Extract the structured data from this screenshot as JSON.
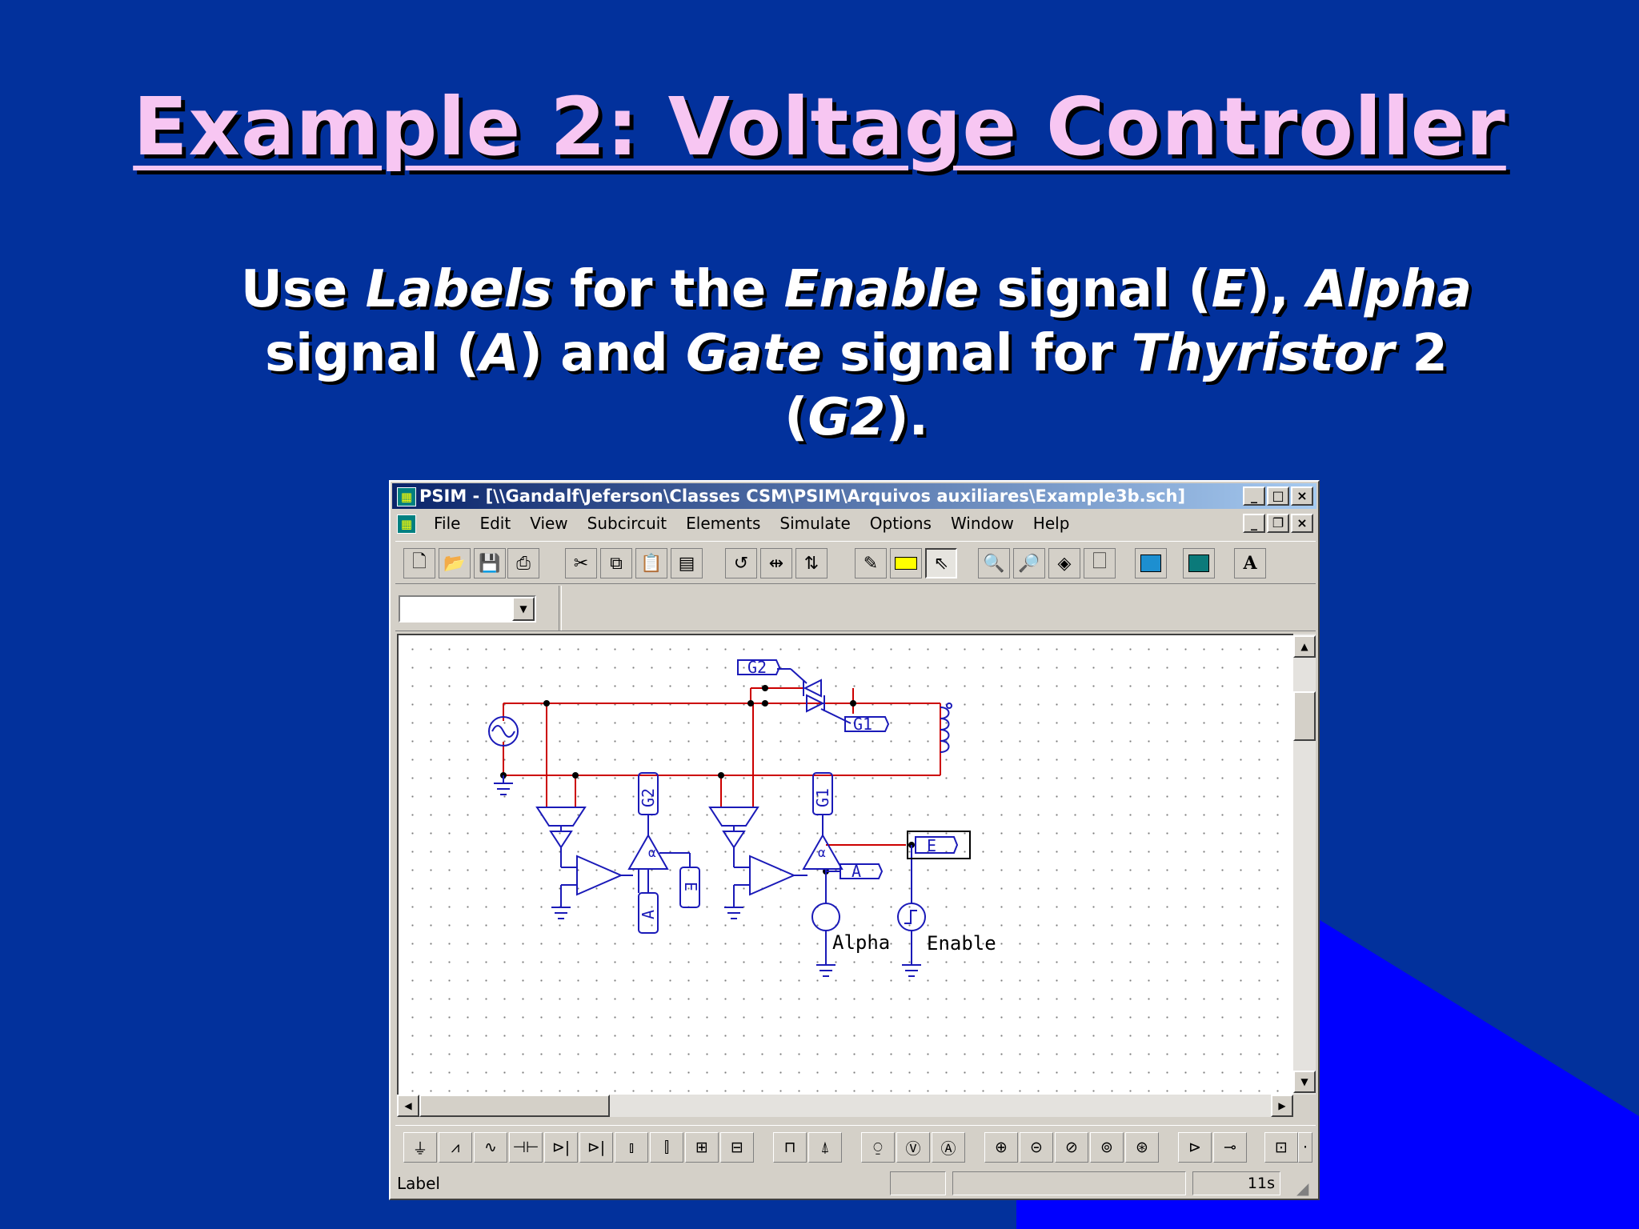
{
  "slide": {
    "title": "Example 2: Voltage Controller",
    "bullet": {
      "t1": "Use ",
      "i1": "Labels",
      "t2": " for the ",
      "i2": "Enable",
      "t3": " signal (",
      "i3": "E",
      "t4": "), ",
      "i4": "Alpha",
      "t5": " signal (",
      "i5": "A",
      "t6": ") and ",
      "i6": "Gate",
      "t7": " signal for ",
      "i7": "Thyristor",
      "t8": " 2 (",
      "i8": "G2",
      "t9": ")."
    }
  },
  "window": {
    "title": "PSIM - [\\\\Gandalf\\Jeferson\\Classes CSM\\PSIM\\Arquivos auxiliares\\Example3b.sch]",
    "menu": [
      "File",
      "Edit",
      "View",
      "Subcircuit",
      "Elements",
      "Simulate",
      "Options",
      "Window",
      "Help"
    ],
    "combo_value": "",
    "status": {
      "left": "Label",
      "right": "11s"
    }
  },
  "schematic": {
    "labels": {
      "g2_top": "G2",
      "g1_top": "G1",
      "g2_vert": "G2",
      "g1_vert": "G1",
      "a_vert": "A",
      "e_vert": "E",
      "e_box": "E",
      "a_box": "A"
    },
    "texts": {
      "alpha": "Alpha",
      "enable": "Enable"
    }
  },
  "colors": {
    "background": "#02319c",
    "title": "#f7c6f2",
    "wire": "#cc0000",
    "component": "#1a1ab8",
    "accent_triangle": "#0000ff"
  }
}
